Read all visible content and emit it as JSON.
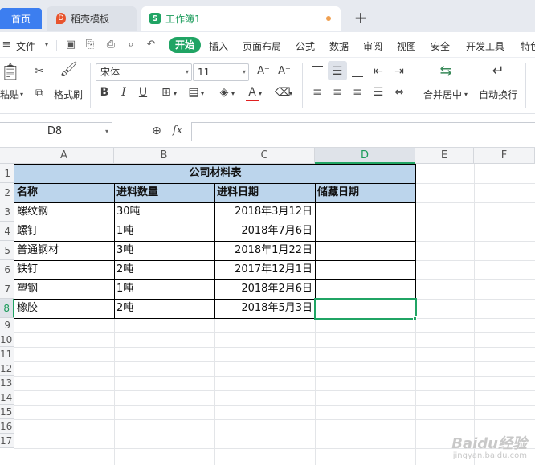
{
  "tabs": {
    "home": "首页",
    "template": "稻壳模板",
    "workbook": "工作簿1",
    "add": "+"
  },
  "menu": {
    "file": "文件",
    "start": "开始",
    "items": [
      "插入",
      "页面布局",
      "公式",
      "数据",
      "审阅",
      "视图",
      "安全",
      "开发工具",
      "特色"
    ]
  },
  "ribbon": {
    "paste": "粘贴",
    "format_painter": "格式刷",
    "font_name": "宋体",
    "font_size": "11",
    "merge_center": "合并居中",
    "auto_wrap": "自动换行"
  },
  "formula_bar": {
    "cell_ref": "D8",
    "fx": "fx",
    "content": ""
  },
  "grid": {
    "columns": [
      "A",
      "B",
      "C",
      "D",
      "E",
      "F"
    ],
    "rows": [
      "1",
      "2",
      "3",
      "4",
      "5",
      "6",
      "7",
      "8",
      "9",
      "10",
      "11",
      "12",
      "13",
      "14",
      "15",
      "16",
      "17"
    ],
    "selected_cell": "D8"
  },
  "sheet": {
    "title": "公司材料表",
    "headers": [
      "名称",
      "进料数量",
      "进料日期",
      "储藏日期"
    ],
    "rows": [
      [
        "螺纹钢",
        "30吨",
        "2018年3月12日",
        ""
      ],
      [
        "螺钉",
        "1吨",
        "2018年7月6日",
        ""
      ],
      [
        "普通钢材",
        "3吨",
        "2018年1月22日",
        ""
      ],
      [
        "铁钉",
        "2吨",
        "2017年12月1日",
        ""
      ],
      [
        "塑钢",
        "1吨",
        "2018年2月6日",
        ""
      ],
      [
        "橡胶",
        "2吨",
        "2018年5月3日",
        ""
      ]
    ]
  },
  "colors": {
    "accent_green": "#20a464",
    "tab_blue": "#3c7ef0",
    "header_fill": "#bcd5ec"
  },
  "watermark": {
    "main": "Baidu经验",
    "sub": "jingyan.baidu.com"
  }
}
